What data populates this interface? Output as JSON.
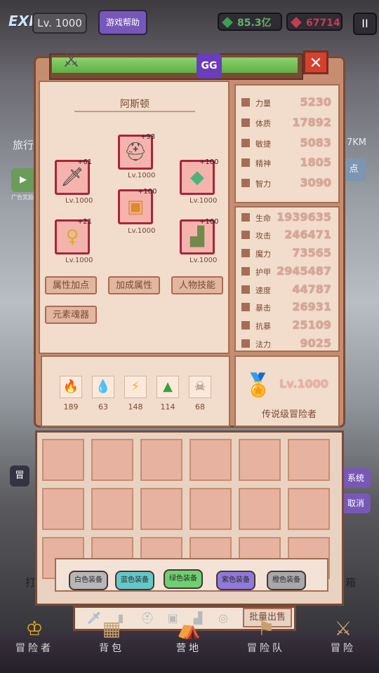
{
  "topbar": {
    "exp_label": "EXP",
    "level": "Lv. 1000",
    "help": "游戏帮助",
    "green_gems": "85.3亿",
    "red_gems": "67714",
    "pause": "II"
  },
  "background": {
    "travel": "旅行",
    "distance": "7KM",
    "point": "点",
    "ad": "广告奖励",
    "adventure": "冒",
    "system": "系统",
    "cancel": "取消",
    "hit": "打",
    "box": "箱"
  },
  "character": {
    "name": "阿斯顿",
    "gg": "GG",
    "close": "✕"
  },
  "equipment": [
    {
      "name": "helmet-slot",
      "icon": "helmet-icon",
      "glyph": "⛑",
      "plus": "+93",
      "level": "Lv.1000"
    },
    {
      "name": "weapon-slot",
      "icon": "sword-icon",
      "glyph": "🗡",
      "plus": "+61",
      "level": "Lv.1000"
    },
    {
      "name": "crystal-slot",
      "icon": "crystal-icon",
      "glyph": "◆",
      "plus": "+100",
      "level": "Lv.1000"
    },
    {
      "name": "armor-slot",
      "icon": "armor-icon",
      "glyph": "▣",
      "plus": "+100",
      "level": "Lv.1000"
    },
    {
      "name": "amulet-slot",
      "icon": "amulet-icon",
      "glyph": "♀",
      "plus": "+21",
      "level": "Lv.1000"
    },
    {
      "name": "boots-slot",
      "icon": "boots-icon",
      "glyph": "▟",
      "plus": "+100",
      "level": "Lv.1000"
    }
  ],
  "actions": {
    "attr_points": "属性加点",
    "bonus_attr": "加成属性",
    "skills": "人物技能",
    "elements": "元素魂器"
  },
  "base_stats": [
    {
      "label": "力量",
      "value": "5230"
    },
    {
      "label": "体质",
      "value": "17892"
    },
    {
      "label": "敏捷",
      "value": "5083"
    },
    {
      "label": "精神",
      "value": "1805"
    },
    {
      "label": "智力",
      "value": "3090"
    }
  ],
  "combat_stats": [
    {
      "label": "生命",
      "value": "1939635"
    },
    {
      "label": "攻击",
      "value": "246471"
    },
    {
      "label": "魔力",
      "value": "73565"
    },
    {
      "label": "护甲",
      "value": "2945487"
    },
    {
      "label": "速度",
      "value": "44787"
    },
    {
      "label": "暴击",
      "value": "26931"
    },
    {
      "label": "抗暴",
      "value": "25109"
    },
    {
      "label": "法力",
      "value": "9025"
    }
  ],
  "elements": [
    {
      "icon": "fire-icon",
      "glyph": "🔥",
      "value": "189",
      "color": "#e64a2e"
    },
    {
      "icon": "water-icon",
      "glyph": "💧",
      "value": "63",
      "color": "#3a8de0"
    },
    {
      "icon": "lightning-icon",
      "glyph": "⚡",
      "value": "148",
      "color": "#f0b020"
    },
    {
      "icon": "earth-icon",
      "glyph": "▲",
      "value": "114",
      "color": "#3aa040"
    },
    {
      "icon": "skull-icon",
      "glyph": "☠",
      "value": "68",
      "color": "#8a6a60"
    }
  ],
  "rank": {
    "level": "Lv.1000",
    "title": "传说级冒险者"
  },
  "filters": [
    {
      "label": "白色装备",
      "color": "#b7b7b7"
    },
    {
      "label": "蓝色装备",
      "color": "#63c8c8"
    },
    {
      "label": "绿色装备",
      "color": "#6fd070"
    },
    {
      "label": "紫色装备",
      "color": "#8f79d9"
    },
    {
      "label": "橙色装备",
      "color": "#a8a8a8"
    }
  ],
  "tabs": {
    "icons": [
      "sword-tab-icon",
      "armor-tab-icon",
      "helmet-tab-icon",
      "chest-tab-icon",
      "boots-tab-icon",
      "ring-tab-icon"
    ],
    "glyphs": [
      "🗡",
      "▮",
      "⛑",
      "▣",
      "▟",
      "◎"
    ],
    "sell": "批量出售"
  },
  "nav": [
    {
      "label": "冒险者",
      "glyph": "♔",
      "icon": "adventurer-icon"
    },
    {
      "label": "背包",
      "glyph": "▦",
      "icon": "bag-icon"
    },
    {
      "label": "营地",
      "glyph": "⛺",
      "icon": "camp-icon"
    },
    {
      "label": "冒险队",
      "glyph": "⚑",
      "icon": "team-icon"
    },
    {
      "label": "冒险",
      "glyph": "⚔",
      "icon": "adventure-icon"
    }
  ]
}
